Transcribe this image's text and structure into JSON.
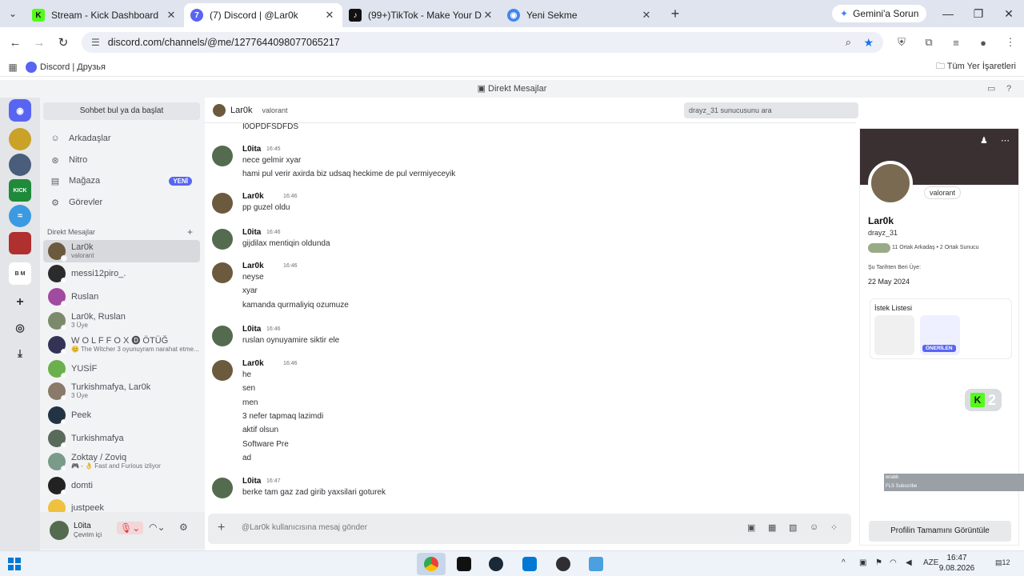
{
  "browser": {
    "tabs": [
      {
        "title": "Stream - Kick Dashboard",
        "favicon": "kick-icon",
        "color": "#53fc18",
        "glyph": "K"
      },
      {
        "title": "(7) Discord | @Lar0k",
        "favicon": "discord-icon",
        "color": "#5865f2",
        "glyph": "7"
      },
      {
        "title": "(99+)TikTok - Make Your Day",
        "favicon": "tiktok-icon",
        "color": "#111111",
        "glyph": "♪"
      },
      {
        "title": "Yeni Sekme",
        "favicon": "chrome-icon",
        "color": "#4285f4",
        "glyph": "◉"
      }
    ],
    "gemini": "Gemini'a Sorun",
    "url": "discord.com/channels/@me/1277644098077065217",
    "bookmark": "Discord | Друзья",
    "all_bookmarks": "Tüm Yer İşaretleri"
  },
  "discord": {
    "title": "Direkt Mesajlar",
    "search_dm": "Sohbet bul ya da başlat",
    "nav": [
      {
        "label": "Arkadaşlar",
        "icon": "friends-icon"
      },
      {
        "label": "Nitro",
        "icon": "nitro-icon"
      },
      {
        "label": "Mağaza",
        "icon": "shop-icon",
        "badge": "YENİ"
      },
      {
        "label": "Görevler",
        "icon": "quests-icon"
      }
    ],
    "dm_header": "Direkt Mesajlar",
    "dms": [
      {
        "name": "Lar0k",
        "sub": "valorant",
        "color": "#6b5a3e",
        "selected": true
      },
      {
        "name": "messi12piro_.",
        "sub": "",
        "color": "#2b2b2b"
      },
      {
        "name": "Ruslan",
        "sub": "",
        "color": "#a04aa0"
      },
      {
        "name": "Lar0k, Ruslan",
        "sub": "3 Üye",
        "color": "#7b8a6a"
      },
      {
        "name": "W O L F F O X 🅓 ÖTÜĞ",
        "sub": "😊 The Witcher 3 oyunuyram narahat etme...",
        "color": "#333355"
      },
      {
        "name": "YUSİF",
        "sub": "",
        "color": "#6ab04c"
      },
      {
        "name": "Turkishmafya, Lar0k",
        "sub": "3 Üye",
        "color": "#8a7a6a"
      },
      {
        "name": "Peek",
        "sub": "",
        "color": "#223344"
      },
      {
        "name": "Turkishmafya",
        "sub": "",
        "color": "#5a6a5a"
      },
      {
        "name": "Zoktay / Zoviq",
        "sub": "🎮 - 👌 Fast and Furious izliyor",
        "color": "#7a9a8a"
      },
      {
        "name": "domti",
        "sub": "",
        "color": "#222222"
      },
      {
        "name": "justpeek",
        "sub": "",
        "color": "#f0c040"
      }
    ],
    "user": {
      "name": "L0ita",
      "status": "Çevrim içi"
    },
    "chat": {
      "name": "Lar0k",
      "status": "valorant",
      "search_placeholder": "drayz_31 sunucusunu ara",
      "top_line": "I0OPDFSDFDS",
      "messages": [
        {
          "author": "L0ita",
          "time": "16:45",
          "lines": [
            "nece gelmir xyar",
            "hami pul verir axirda biz udsaq heckime de pul vermiyeceyik"
          ]
        },
        {
          "author": "Lar0k",
          "time": "16:46",
          "lines": [
            "pp guzel oldu"
          ]
        },
        {
          "author": "L0ita",
          "time": "16:46",
          "lines": [
            "gijdilax mentiqin oldunda"
          ]
        },
        {
          "author": "Lar0k",
          "time": "16:46",
          "lines": [
            "neyse",
            "xyar",
            "kamanda qurmaliyiq ozumuze"
          ]
        },
        {
          "author": "L0ita",
          "time": "16:46",
          "lines": [
            "ruslan oynuyamire siktir ele"
          ]
        },
        {
          "author": "Lar0k",
          "time": "16:46",
          "lines": [
            "he",
            "sen",
            "men",
            "3 nefer tapmaq lazimdi",
            "aktif olsun",
            "Software Pre",
            "ad"
          ]
        },
        {
          "author": "L0ita",
          "time": "16:47",
          "lines": [
            "berke tam gaz zad girib yaxsilari goturek"
          ]
        }
      ],
      "composer_placeholder": "@Lar0k kullanıcısına mesaj gönder"
    },
    "profile": {
      "status": "valorant",
      "name": "Lar0k",
      "handle": "drayz_31",
      "mutual": "11 Ortak Arkadaş • 2 Ortak Sunucu",
      "member_since_label": "Şu Tarihten Beri Üye:",
      "member_since": "22 May 2024",
      "wishlist": "İstek Listesi",
      "recommended": "ÖNERİLEN",
      "view_full": "Profilin Tamamını Görüntüle"
    }
  },
  "overlay": {
    "kick_count": "2",
    "line1": "wrabb",
    "line2": "FLS Subscribe"
  },
  "taskbar": {
    "lang": "AZE",
    "time": "16:47",
    "date": "9.08.2026",
    "notif": "12"
  }
}
